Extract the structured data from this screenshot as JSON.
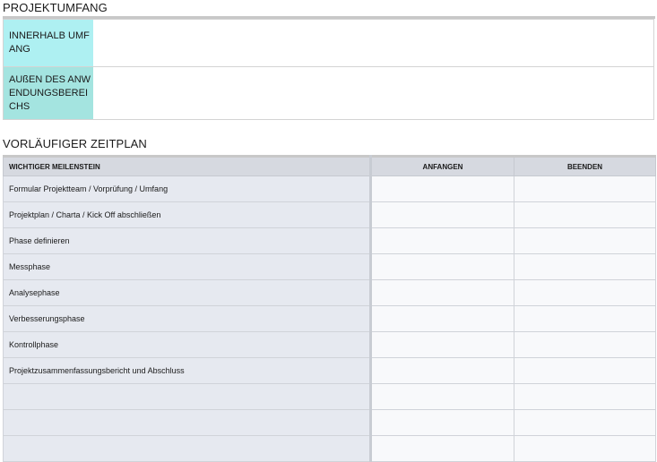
{
  "scope": {
    "title": "PROJEKTUMFANG",
    "rows": [
      {
        "label": "INNERHALB UMFANG",
        "value": ""
      },
      {
        "label": "AUßEN DES ANWENDUNGSBEREICHS",
        "value": ""
      }
    ]
  },
  "schedule": {
    "title": "VORLÄUFIGER ZEITPLAN",
    "headers": [
      "WICHTIGER MEILENSTEIN",
      "ANFANGEN",
      "BEENDEN"
    ],
    "rows": [
      {
        "milestone": "Formular Projektteam / Vorprüfung / Umfang",
        "start": "",
        "end": ""
      },
      {
        "milestone": "Projektplan / Charta / Kick Off abschließen",
        "start": "",
        "end": ""
      },
      {
        "milestone": "Phase definieren",
        "start": "",
        "end": ""
      },
      {
        "milestone": "Messphase",
        "start": "",
        "end": ""
      },
      {
        "milestone": "Analysephase",
        "start": "",
        "end": ""
      },
      {
        "milestone": "Verbesserungsphase",
        "start": "",
        "end": ""
      },
      {
        "milestone": "Kontrollphase",
        "start": "",
        "end": ""
      },
      {
        "milestone": "Projektzusammenfassungsbericht und Abschluss",
        "start": "",
        "end": ""
      },
      {
        "milestone": "",
        "start": "",
        "end": ""
      },
      {
        "milestone": "",
        "start": "",
        "end": ""
      },
      {
        "milestone": "",
        "start": "",
        "end": ""
      }
    ]
  }
}
